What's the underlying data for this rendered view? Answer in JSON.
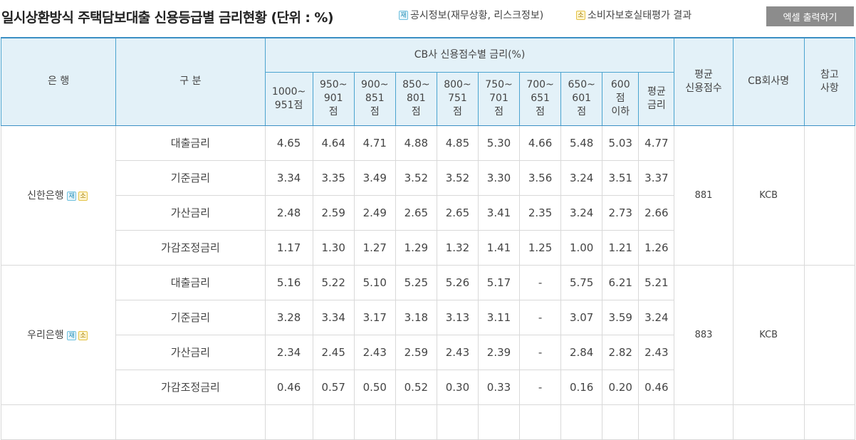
{
  "page": {
    "title": "일시상환방식 주택담보대출 신용등급별 금리현황 (단위 : %)",
    "legend": [
      {
        "badge": "재",
        "text": "공시정보(재무상황, 리스크정보)"
      },
      {
        "badge": "소",
        "text": "소비자보호실태평가 결과"
      }
    ],
    "excel_button": "엑셀 출력하기"
  },
  "table": {
    "headers": {
      "bank": "은 행",
      "gubun": "구 분",
      "group": "CB사 신용점수별 금리(%)",
      "bands": [
        [
          "1000~",
          "951점"
        ],
        [
          "950~",
          "901",
          "점"
        ],
        [
          "900~",
          "851",
          "점"
        ],
        [
          "850~",
          "801",
          "점"
        ],
        [
          "800~",
          "751",
          "점"
        ],
        [
          "750~",
          "701",
          "점"
        ],
        [
          "700~",
          "651",
          "점"
        ],
        [
          "650~",
          "601",
          "점"
        ],
        [
          "600",
          "점",
          "이하"
        ],
        [
          "평균",
          "금리"
        ]
      ],
      "avg_score": [
        "평균",
        "신용점수"
      ],
      "cb_company": "CB회사명",
      "note": [
        "참고",
        "사항"
      ]
    },
    "banks": [
      {
        "name": "신한은행",
        "badges": [
          "재",
          "소"
        ],
        "avg_score": "881",
        "cb_company": "KCB",
        "note": "",
        "rows": [
          {
            "label": "대출금리",
            "values": [
              "4.65",
              "4.64",
              "4.71",
              "4.88",
              "4.85",
              "5.30",
              "4.66",
              "5.48",
              "5.03",
              "4.77"
            ]
          },
          {
            "label": "기준금리",
            "values": [
              "3.34",
              "3.35",
              "3.49",
              "3.52",
              "3.52",
              "3.30",
              "3.56",
              "3.24",
              "3.51",
              "3.37"
            ]
          },
          {
            "label": "가산금리",
            "values": [
              "2.48",
              "2.59",
              "2.49",
              "2.65",
              "2.65",
              "3.41",
              "2.35",
              "3.24",
              "2.73",
              "2.66"
            ]
          },
          {
            "label": "가감조정금리",
            "values": [
              "1.17",
              "1.30",
              "1.27",
              "1.29",
              "1.32",
              "1.41",
              "1.25",
              "1.00",
              "1.21",
              "1.26"
            ]
          }
        ]
      },
      {
        "name": "우리은행",
        "badges": [
          "재",
          "소"
        ],
        "avg_score": "883",
        "cb_company": "KCB",
        "note": "",
        "rows": [
          {
            "label": "대출금리",
            "values": [
              "5.16",
              "5.22",
              "5.10",
              "5.25",
              "5.26",
              "5.17",
              "-",
              "5.75",
              "6.21",
              "5.21"
            ]
          },
          {
            "label": "기준금리",
            "values": [
              "3.28",
              "3.34",
              "3.17",
              "3.18",
              "3.13",
              "3.11",
              "-",
              "3.07",
              "3.59",
              "3.24"
            ]
          },
          {
            "label": "가산금리",
            "values": [
              "2.34",
              "2.45",
              "2.43",
              "2.59",
              "2.43",
              "2.39",
              "-",
              "2.84",
              "2.82",
              "2.43"
            ]
          },
          {
            "label": "가감조정금리",
            "values": [
              "0.46",
              "0.57",
              "0.50",
              "0.52",
              "0.30",
              "0.33",
              "-",
              "0.16",
              "0.20",
              "0.46"
            ]
          }
        ]
      }
    ]
  }
}
